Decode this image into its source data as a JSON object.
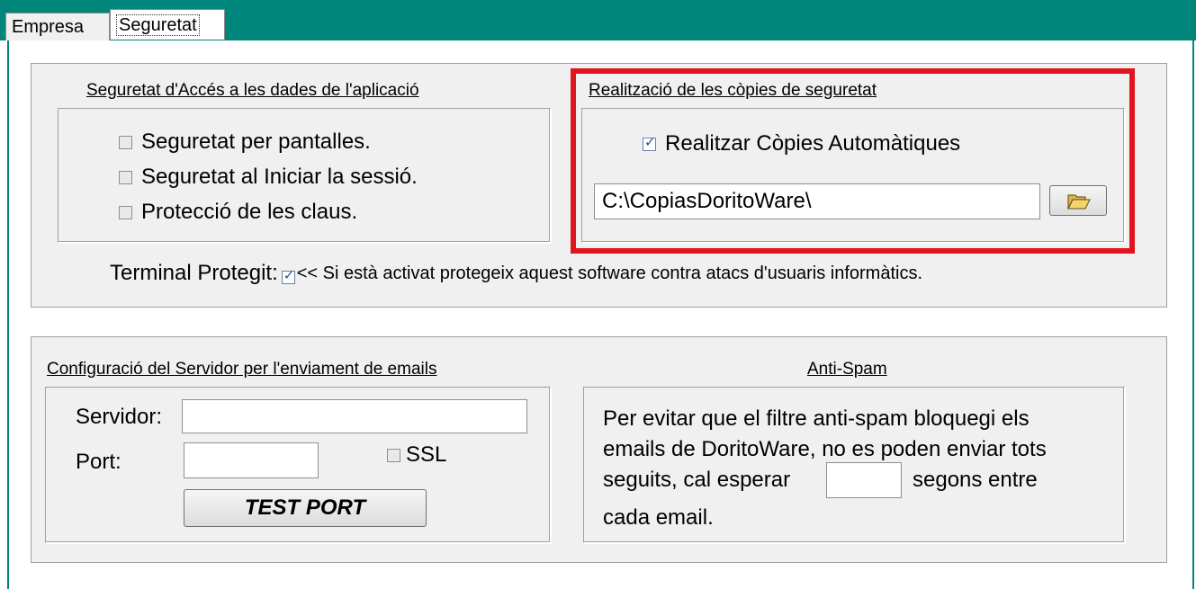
{
  "tabs": [
    {
      "label": "Empresa"
    },
    {
      "label": "Seguretat"
    }
  ],
  "security": {
    "heading": "Seguretat d'Accés a les dades de l'aplicació",
    "options": [
      {
        "label": "Seguretat per pantalles.",
        "checked": false
      },
      {
        "label": "Seguretat al Iniciar la sessió.",
        "checked": false
      },
      {
        "label": "Protecció de les claus.",
        "checked": false
      }
    ],
    "terminal_label": "Terminal Protegit:",
    "terminal_note": "<< Si està activat protegeix aquest software contra atacs d'usuaris informàtics."
  },
  "backup": {
    "heading": "Realització de les còpies de seguretat",
    "auto_label": "Realitzar Còpies Automàtiques",
    "auto_checked": true,
    "path_value": "C:\\CopiasDoritoWare\\"
  },
  "email": {
    "heading": "Configuració del Servidor per l'enviament de emails",
    "server_label": "Servidor:",
    "server_value": "",
    "port_label": "Port:",
    "port_value": "",
    "ssl_label": "SSL",
    "test_button": "TEST PORT"
  },
  "antispam": {
    "heading": "Anti-Spam",
    "line1": "Per evitar que el filtre anti-spam bloquegi els",
    "line2": "emails de DoritoWare, no es poden enviar tots",
    "line3a": "seguits, cal esperar",
    "line3b": "segons entre",
    "line4": "cada email.",
    "seconds_value": ""
  },
  "colors": {
    "accent": "#00867a",
    "highlight": "#e0141e"
  }
}
